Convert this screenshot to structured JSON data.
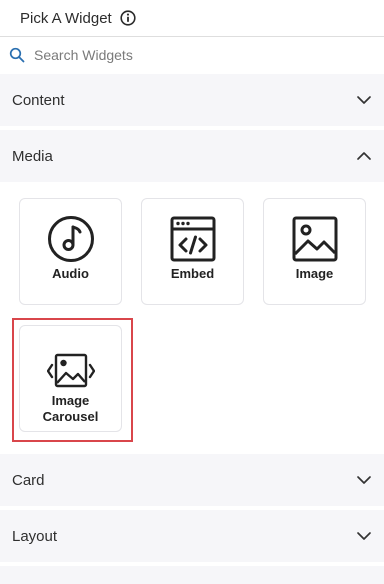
{
  "header": {
    "title": "Pick A Widget",
    "info_icon": "info-icon"
  },
  "search": {
    "placeholder": "Search Widgets",
    "value": "",
    "icon": "search-icon"
  },
  "sections": [
    {
      "label": "Content",
      "expanded": false,
      "chevron": "chevron-down-icon"
    },
    {
      "label": "Media",
      "expanded": true,
      "chevron": "chevron-up-icon"
    },
    {
      "label": "Card",
      "expanded": false,
      "chevron": "chevron-down-icon"
    },
    {
      "label": "Layout",
      "expanded": false,
      "chevron": "chevron-down-icon"
    }
  ],
  "media_widgets": [
    {
      "label": "Audio",
      "icon": "audio-note-icon"
    },
    {
      "label": "Embed",
      "icon": "embed-code-icon"
    },
    {
      "label": "Image",
      "icon": "image-icon"
    },
    {
      "label": "Image Carousel",
      "icon": "image-carousel-icon",
      "selected": true
    }
  ],
  "colors": {
    "selection_outline": "#d9464b",
    "section_bg": "#f6f6f9",
    "accent_icon": "#2a6fb0"
  }
}
